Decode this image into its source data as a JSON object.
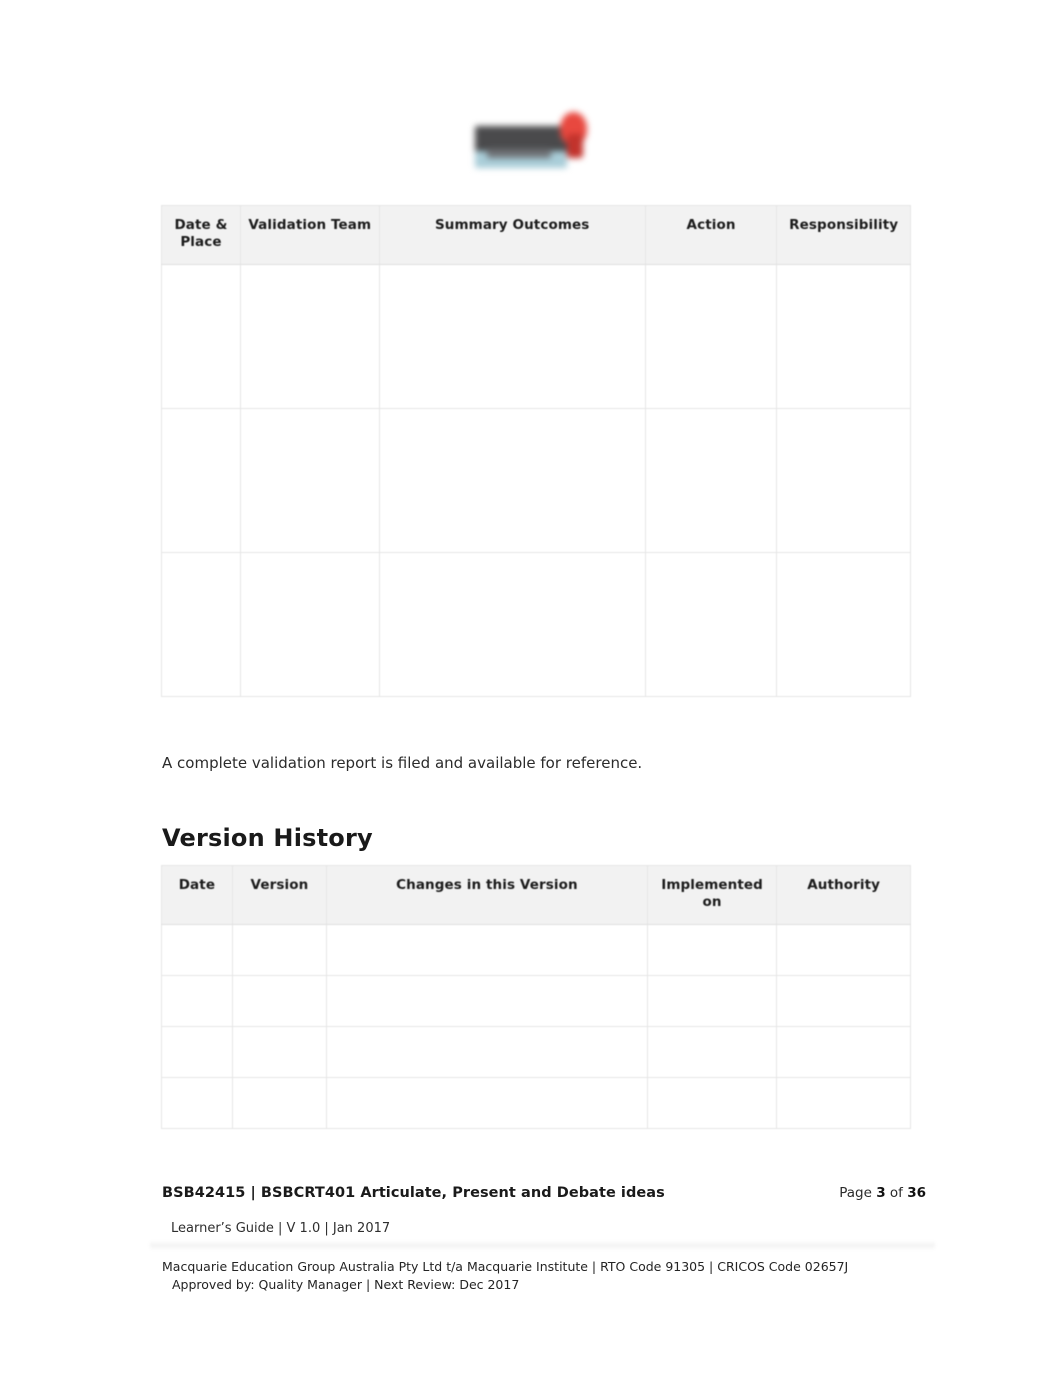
{
  "document": {
    "logo": {
      "icon": "macquarie-institute-logo",
      "description": "blurred organisation logo"
    },
    "validation_table": {
      "name": "validation-outcomes-table",
      "headers": [
        "Date & Place",
        "Validation Team",
        "Summary Outcomes",
        "Action",
        "Responsibility"
      ],
      "rows": [
        [
          "",
          "",
          "",
          "",
          ""
        ],
        [
          "",
          "",
          "",
          "",
          ""
        ],
        [
          "",
          "",
          "",
          "",
          ""
        ]
      ]
    },
    "paragraph": "A complete validation report is filed and available for reference.",
    "section_heading": "Version History",
    "version_table": {
      "name": "version-history-table",
      "headers": [
        "Date",
        "Version",
        "Changes in this Version",
        "Implemented on",
        "Authority"
      ],
      "rows": [
        [
          "",
          "",
          "",
          "",
          ""
        ],
        [
          "",
          "",
          "",
          "",
          ""
        ],
        [
          "",
          "",
          "",
          "",
          ""
        ],
        [
          "",
          "",
          "",
          "",
          ""
        ]
      ]
    },
    "footer": {
      "title": "BSB42415 | BSBCRT401 Articulate, Present and Debate ideas",
      "page_prefix": "Page",
      "page_number": "3",
      "page_of": "of",
      "page_total": "36",
      "subtitle": "Learner’s Guide | V 1.0 | Jan 2017",
      "legal_line1": "Macquarie Education Group Australia Pty Ltd t/a Macquarie Institute | RTO Code 91305 | CRICOS Code 02657J",
      "legal_line2": "Approved by: Quality Manager | Next Review:  Dec 2017"
    },
    "colors": {
      "text": "#222222",
      "table_border": "#e6e6e6",
      "header_fill": "#f2f2f2",
      "logo_red": "#e8483f",
      "logo_blue": "#a9cdd8",
      "logo_dark": "#4a4a4c"
    }
  }
}
